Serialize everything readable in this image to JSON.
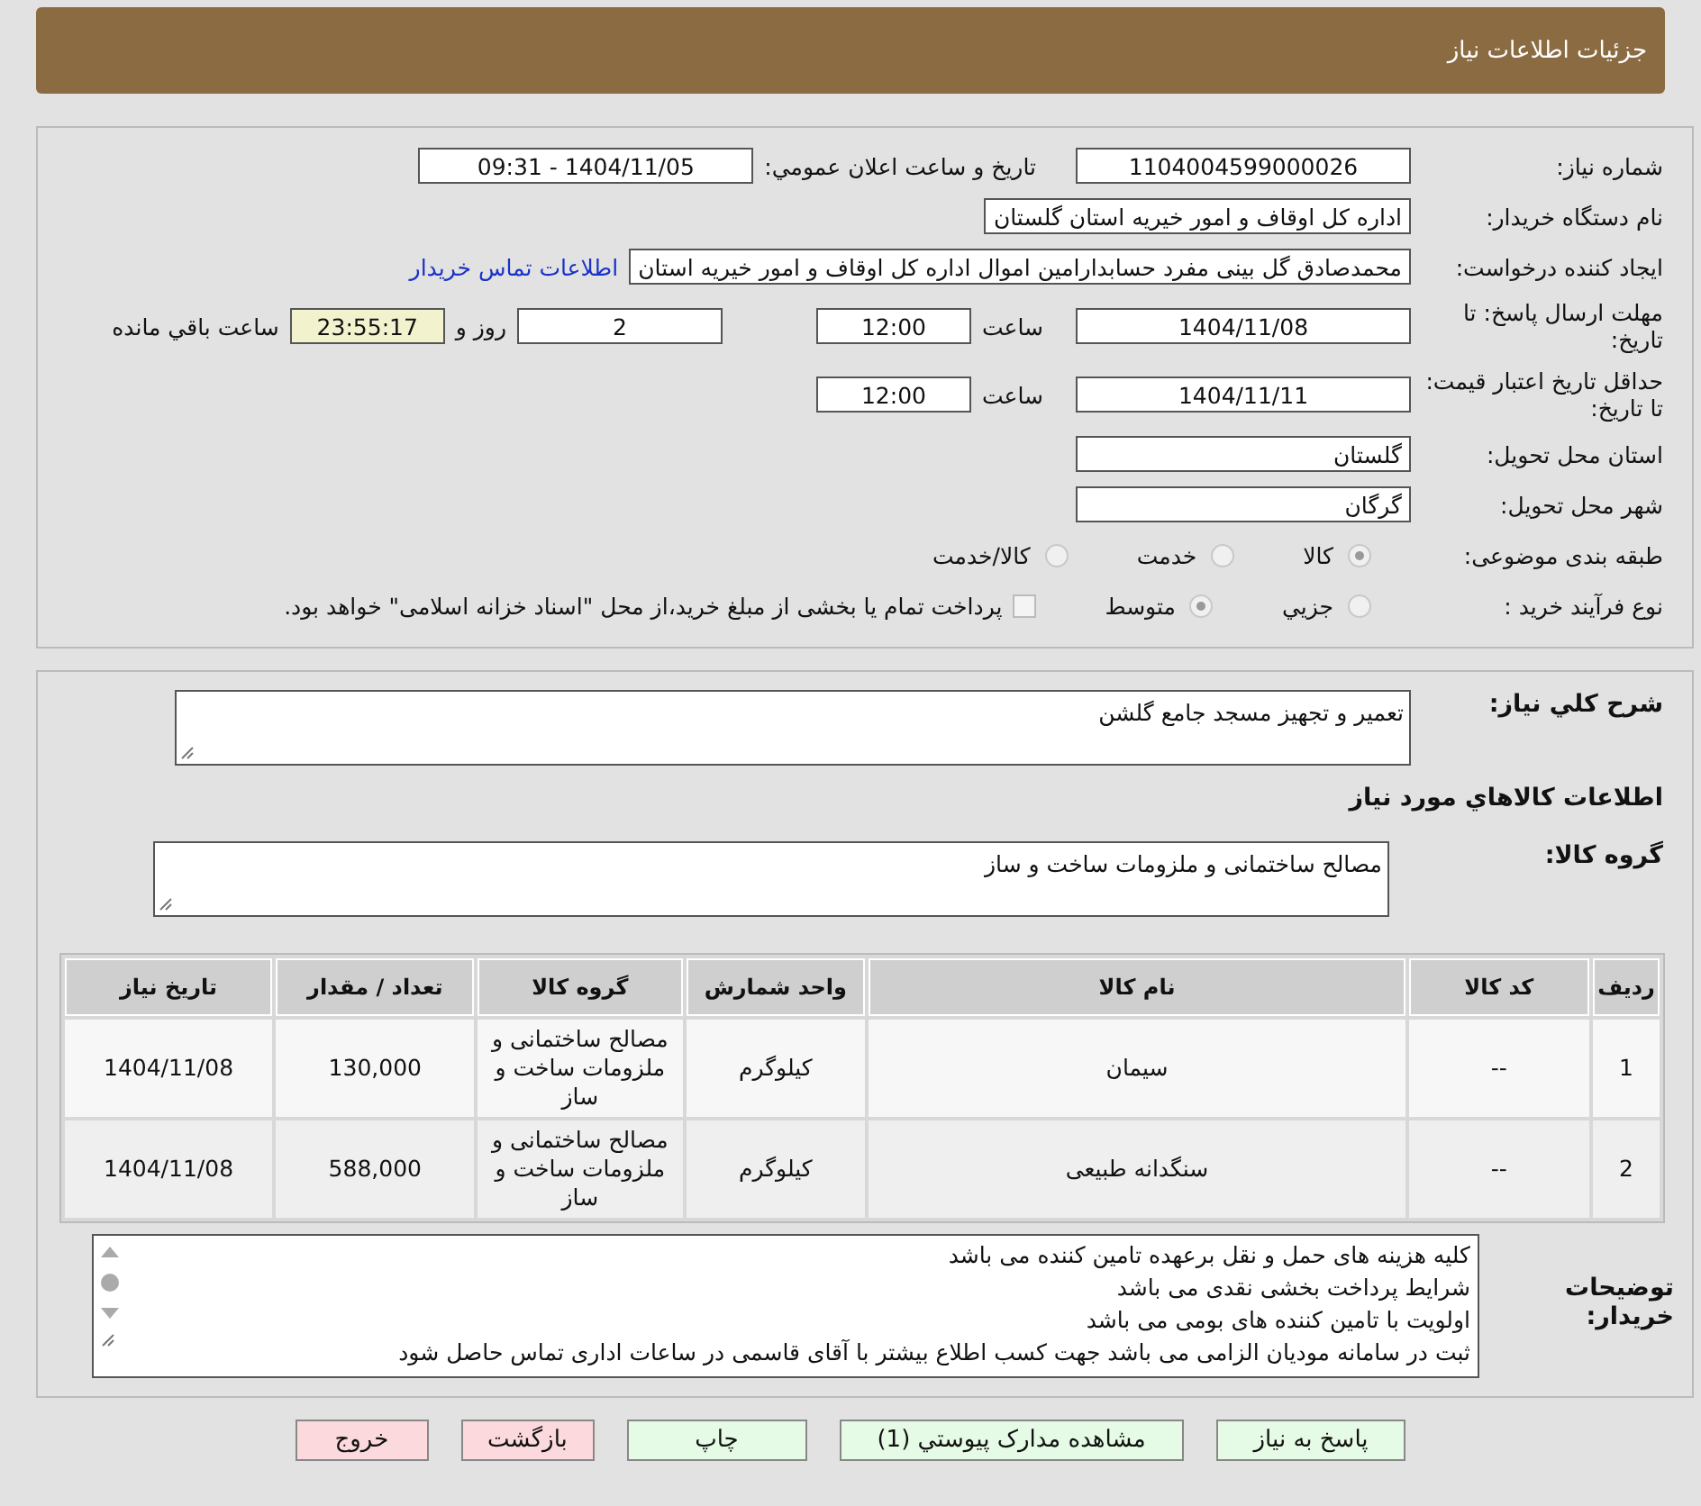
{
  "header": {
    "title": "جزئیات اطلاعات نیاز"
  },
  "need_number": {
    "label": "شماره نیاز:",
    "value": "1104004599000026"
  },
  "announce": {
    "label": "تاريخ و ساعت اعلان عمومي:",
    "value": "1404/11/05 - 09:31"
  },
  "buyer_org": {
    "label": "نام دستگاه خریدار:",
    "value": "اداره کل اوقاف و امور خیریه استان گلستان"
  },
  "requester": {
    "label": "ایجاد کننده درخواست:",
    "value": "محمدصادق گل بینی مفرد حسابدارامین اموال اداره کل اوقاف و امور خیریه استان",
    "link": "اطلاعات تماس خریدار"
  },
  "deadline": {
    "label": "مهلت ارسال پاسخ: تا تاریخ:",
    "date": "1404/11/08",
    "time_label": "ساعت",
    "time": "12:00",
    "days": "2",
    "days_label": "روز و",
    "remaining": "23:55:17",
    "remaining_label": "ساعت باقي مانده"
  },
  "validity": {
    "label": "حداقل تاریخ اعتبار قیمت: تا تاریخ:",
    "date": "1404/11/11",
    "time_label": "ساعت",
    "time": "12:00"
  },
  "province": {
    "label": "استان محل تحویل:",
    "value": "گلستان"
  },
  "city": {
    "label": "شهر محل تحویل:",
    "value": "گرگان"
  },
  "category": {
    "label": "طبقه بندی موضوعی:",
    "options": [
      {
        "label": "کالا",
        "selected": true
      },
      {
        "label": "خدمت",
        "selected": false
      },
      {
        "label": "کالا/خدمت",
        "selected": false
      }
    ]
  },
  "process": {
    "label": "نوع فرآیند خرید :",
    "options": [
      {
        "label": "جزيي",
        "selected": false
      },
      {
        "label": "متوسط",
        "selected": true
      }
    ],
    "payment": {
      "checked": false,
      "label": "پرداخت تمام یا بخشی از مبلغ خرید،از محل \"اسناد خزانه اسلامی\" خواهد بود."
    }
  },
  "description": {
    "label": "شرح کلي نياز:",
    "value": "تعمیر و تجهیز مسجد جامع گلشن"
  },
  "goods_title": "اطلاعات کالاهاي مورد نياز",
  "goods_group": {
    "label": "گروه کالا:",
    "value": "مصالح ساختمانی و ملزومات ساخت و ساز"
  },
  "table": {
    "columns": [
      "ردیف",
      "کد کالا",
      "نام کالا",
      "واحد شمارش",
      "گروه کالا",
      "تعداد / مقدار",
      "تاریخ نیاز"
    ],
    "rows": [
      [
        "1",
        "--",
        "سیمان",
        "کیلوگرم",
        "مصالح ساختمانی و ملزومات ساخت و ساز",
        "130,000",
        "1404/11/08"
      ],
      [
        "2",
        "--",
        "سنگدانه طبیعی",
        "کیلوگرم",
        "مصالح ساختمانی و ملزومات ساخت و ساز",
        "588,000",
        "1404/11/08"
      ]
    ]
  },
  "notes": {
    "label": "توضیحات خریدار:",
    "lines": [
      "کلیه هزینه های حمل و نقل برعهده تامین کننده می باشد",
      "شرایط پرداخت بخشی نقدی می باشد",
      "اولویت با تامین کننده های بومی می باشد",
      "ثبت در سامانه مودیان الزامی می باشد جهت کسب اطلاع بیشتر با آقای قاسمی در ساعات اداری تماس حاصل شود"
    ]
  },
  "buttons": [
    {
      "label": "پاسخ به نیاز",
      "kind": "positive"
    },
    {
      "label": "مشاهده مدارک پیوستي (1)",
      "kind": "positive"
    },
    {
      "label": "چاپ",
      "kind": "positive"
    },
    {
      "label": "بازگشت",
      "kind": "negative"
    },
    {
      "label": "خروج",
      "kind": "negative"
    }
  ]
}
